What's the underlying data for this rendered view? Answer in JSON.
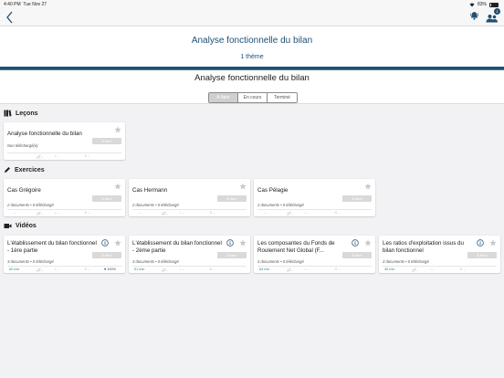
{
  "status": {
    "time": "4:40 PM",
    "date": "Tue Nov 27",
    "battery": "83%"
  },
  "navbar": {
    "badge": "1"
  },
  "header": {
    "title": "Analyse fonctionnelle du bilan",
    "subtitle": "1 thème"
  },
  "topic": {
    "title": "Analyse fonctionnelle du bilan",
    "segments": [
      "À faire",
      "En cours",
      "Terminé"
    ]
  },
  "sections": {
    "lecons": {
      "label": "Leçons",
      "cards": [
        {
          "title": "Analyse fonctionnelle du bilan",
          "meta": "Non téléchargé(e)",
          "button": "À faire",
          "f1": "-",
          "f2": "-",
          "f3": "-"
        }
      ]
    },
    "exercices": {
      "label": "Exercices",
      "cards": [
        {
          "title": "Cas Grégoire",
          "meta": "2 documents  •  0 téléchargé",
          "button": "À faire",
          "f0": "-",
          "f1": "-",
          "f2": "-",
          "f3": "-"
        },
        {
          "title": "Cas Hermann",
          "meta": "2 documents  •  0 téléchargé",
          "button": "À faire",
          "f0": "-",
          "f1": "-",
          "f2": "-",
          "f3": "-"
        },
        {
          "title": "Cas Pélagie",
          "meta": "2 documents  •  0 téléchargé",
          "button": "À faire",
          "f0": "-",
          "f1": "-",
          "f2": "-",
          "f3": "-"
        }
      ]
    },
    "videos": {
      "label": "Vidéos",
      "cards": [
        {
          "title": "L'établissement du bilan fonctionnel - 1ère partie",
          "meta": "3 documents  •  0 téléchargé",
          "button": "À faire",
          "duration": "60 min",
          "f1": "-",
          "f2": "-",
          "f3": "-",
          "pct": "100%"
        },
        {
          "title": "L'établissement du bilan fonctionnel - 2ème partie",
          "meta": "3 documents  •  0 téléchargé",
          "button": "À faire",
          "duration": "51 min",
          "f1": "-",
          "f2": "-",
          "f3": "-"
        },
        {
          "title": "Les composantes du Fonds de Roulement Net Global (F...",
          "meta": "3 documents  •  0 téléchargé",
          "button": "À faire",
          "duration": "64 min",
          "f1": "-",
          "f2": "-",
          "f3": "-"
        },
        {
          "title": "Les ratios d'exploitation issus du bilan fonctionnel",
          "meta": "3 documents  •  0 téléchargé",
          "button": "À faire",
          "duration": "30 min",
          "f1": "-",
          "f2": "-",
          "f3": "-"
        }
      ]
    }
  },
  "colors": {
    "accent": "#1f4f73",
    "teal": "#3a7f8c",
    "star": "#c8c8c8"
  }
}
